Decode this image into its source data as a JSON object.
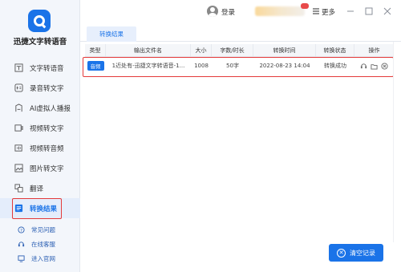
{
  "app": {
    "name": "迅捷文字转语音"
  },
  "sidebar": {
    "items": [
      {
        "label": "文字转语音",
        "icon": "text-to-speech-icon"
      },
      {
        "label": "录音转文字",
        "icon": "recording-icon"
      },
      {
        "label": "AI虚拟人播报",
        "icon": "ai-avatar-icon"
      },
      {
        "label": "视频转文字",
        "icon": "video-text-icon"
      },
      {
        "label": "视频转音频",
        "icon": "video-audio-icon"
      },
      {
        "label": "图片转文字",
        "icon": "image-text-icon"
      },
      {
        "label": "翻译",
        "icon": "translate-icon"
      },
      {
        "label": "转换结果",
        "icon": "result-icon",
        "active": true
      }
    ],
    "bottom_links": [
      {
        "label": "常见问题",
        "icon": "faq-icon"
      },
      {
        "label": "在线客服",
        "icon": "support-icon"
      },
      {
        "label": "进入官网",
        "icon": "website-icon"
      }
    ]
  },
  "topbar": {
    "login_label": "登录",
    "more_label": "更多",
    "window_controls": [
      "minimize",
      "maximize",
      "close"
    ]
  },
  "tabs": [
    {
      "label": "转换结果"
    }
  ],
  "table": {
    "headers": {
      "type": "类型",
      "filename": "输出文件名",
      "size": "大小",
      "words": "字数/时长",
      "time": "转换时间",
      "status": "转换状态",
      "ops": "操作"
    },
    "rows": [
      {
        "type": "音频",
        "filename": "1近处有-迅捷文字转语音-1...",
        "size": "1008",
        "words": "50字",
        "time": "2022-08-23 14:04",
        "status": "转换成功"
      }
    ]
  },
  "actions": {
    "clear_label": "清空记录"
  },
  "colors": {
    "accent": "#1a73e8",
    "highlight": "#e43a3a",
    "sidebar_bg": "#f3f6fb"
  }
}
